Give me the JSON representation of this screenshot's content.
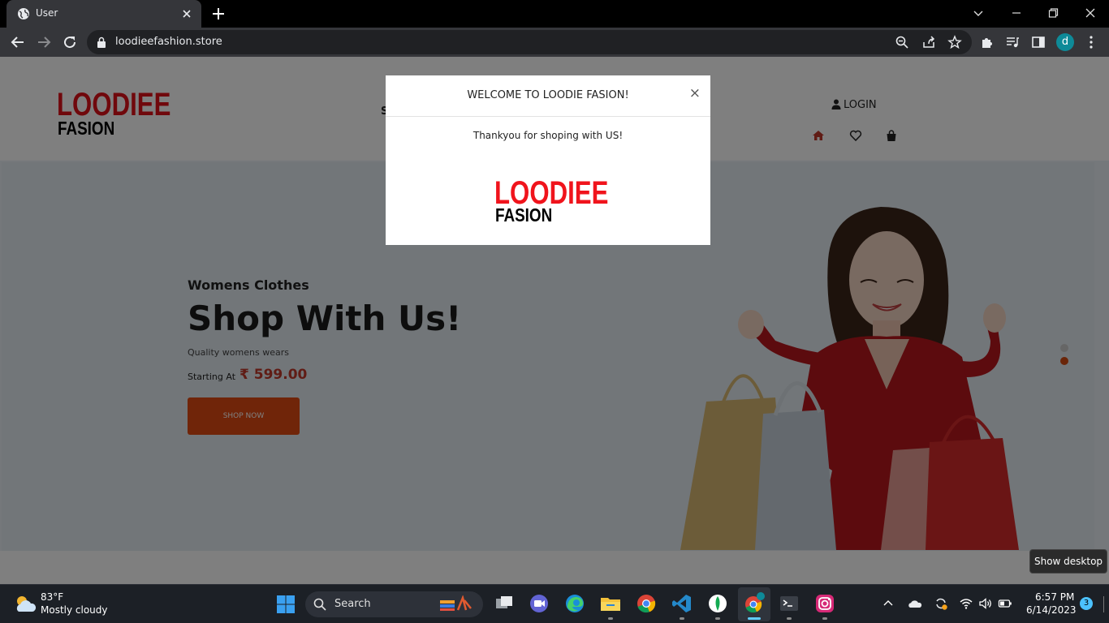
{
  "browser": {
    "tab_title": "User",
    "url": "loodieefashion.store",
    "profile_initial": "d"
  },
  "site": {
    "logo_line1": "LOODIEE",
    "logo_line2": "FASION",
    "nav_partial": "S",
    "login_label": "LOGIN"
  },
  "hero": {
    "subtitle": "Womens Clothes",
    "title": "Shop With Us!",
    "description": "Quality womens wears",
    "price_label": "Starting At",
    "price": "₹ 599.00",
    "button_label": "SHOP NOW"
  },
  "modal": {
    "title": "WELCOME TO LOODIE FASION!",
    "close_symbol": "×",
    "message": "Thankyou for shoping with US!",
    "logo_line1": "LOODIEE",
    "logo_line2": "FASION"
  },
  "tooltip": "Show desktop",
  "taskbar": {
    "weather_temp": "83°F",
    "weather_desc": "Mostly cloudy",
    "search_label": "Search",
    "time": "6:57 PM",
    "date": "6/14/2023",
    "notifications": "3"
  },
  "colors": {
    "brand_red": "#e11018",
    "accent_orange": "#e04a12",
    "chrome_dark": "#35363a"
  }
}
